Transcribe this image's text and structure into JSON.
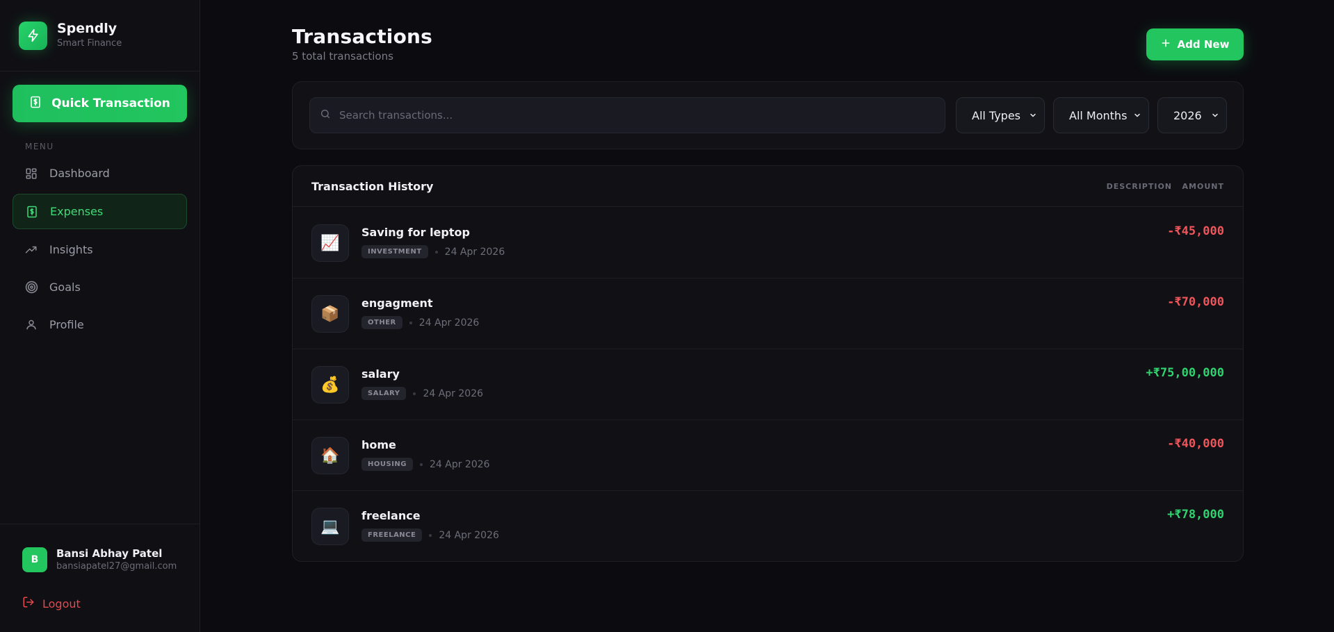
{
  "brand": {
    "name": "Spendly",
    "subtitle": "Smart Finance"
  },
  "quick_transaction_label": "Quick Transaction",
  "menu_label": "MENU",
  "nav": [
    {
      "label": "Dashboard",
      "icon": "grid-icon",
      "active": false
    },
    {
      "label": "Expenses",
      "icon": "dollar-receipt-icon",
      "active": true
    },
    {
      "label": "Insights",
      "icon": "trending-up-icon",
      "active": false
    },
    {
      "label": "Goals",
      "icon": "target-icon",
      "active": false
    },
    {
      "label": "Profile",
      "icon": "user-icon",
      "active": false
    }
  ],
  "user": {
    "initial": "B",
    "name": "Bansi Abhay Patel",
    "email": "bansiapatel27@gmail.com"
  },
  "logout_label": "Logout",
  "page": {
    "title": "Transactions",
    "subtitle": "5 total transactions"
  },
  "add_new_label": "Add New",
  "filters": {
    "search_placeholder": "Search transactions...",
    "type": "All Types",
    "month": "All Months",
    "year": "2026"
  },
  "table": {
    "title": "Transaction History",
    "columns": [
      "DESCRIPTION",
      "AMOUNT"
    ],
    "rows": [
      {
        "icon": "📈",
        "title": "Saving for leptop",
        "tag": "INVESTMENT",
        "date": "24 Apr 2026",
        "amount": "-₹45,000",
        "sign": "neg"
      },
      {
        "icon": "📦",
        "title": "engagment",
        "tag": "OTHER",
        "date": "24 Apr 2026",
        "amount": "-₹70,000",
        "sign": "neg"
      },
      {
        "icon": "💰",
        "title": "salary",
        "tag": "SALARY",
        "date": "24 Apr 2026",
        "amount": "+₹75,00,000",
        "sign": "pos"
      },
      {
        "icon": "🏠",
        "title": "home",
        "tag": "HOUSING",
        "date": "24 Apr 2026",
        "amount": "-₹40,000",
        "sign": "neg"
      },
      {
        "icon": "💻",
        "title": "freelance",
        "tag": "FREELANCE",
        "date": "24 Apr 2026",
        "amount": "+₹78,000",
        "sign": "pos"
      }
    ]
  },
  "colors": {
    "accent": "#22c55e",
    "negative": "#f0555a",
    "positive": "#2fd36f",
    "background": "#0c0c10"
  }
}
